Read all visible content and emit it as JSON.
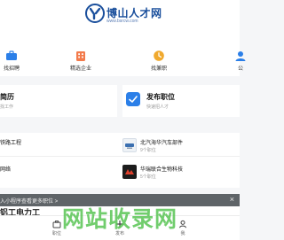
{
  "header": {
    "logo_title": "博山人才网",
    "logo_url": "www.bsrcw.com"
  },
  "nav": {
    "items": [
      {
        "label": "找招聘",
        "icon": "briefcase-icon"
      },
      {
        "label": "精选企业",
        "icon": "building-icon"
      },
      {
        "label": "找兼职",
        "icon": "clock-icon"
      },
      {
        "label": "公",
        "icon": "notice-icon"
      }
    ]
  },
  "cards": {
    "left": {
      "title": "简历",
      "subtitle": "找工作"
    },
    "right": {
      "title": "发布职位",
      "subtitle": "快速招人才"
    }
  },
  "companies": [
    {
      "name": "铁路工程",
      "jobs": ""
    },
    {
      "name": "北汽海华汽车部件",
      "jobs": "9个职位"
    },
    {
      "name": "网络",
      "jobs": ""
    },
    {
      "name": "华瑞联合生物科技",
      "jobs": "5个职位"
    }
  ],
  "banner": {
    "text": "入小程序查看更多职位 >",
    "close": "×"
  },
  "peek": {
    "text": "铝工电力工"
  },
  "tabbar": {
    "items": [
      {
        "label": "职位",
        "icon": "briefcase-icon"
      },
      {
        "label": "发布",
        "icon": "plus-icon"
      },
      {
        "label": "我",
        "icon": "user-icon"
      }
    ]
  },
  "watermark": {
    "text": "网站收录网"
  },
  "colors": {
    "brand": "#1a4f9c",
    "accent": "#2b7fe8",
    "watermark": "#58c454"
  }
}
